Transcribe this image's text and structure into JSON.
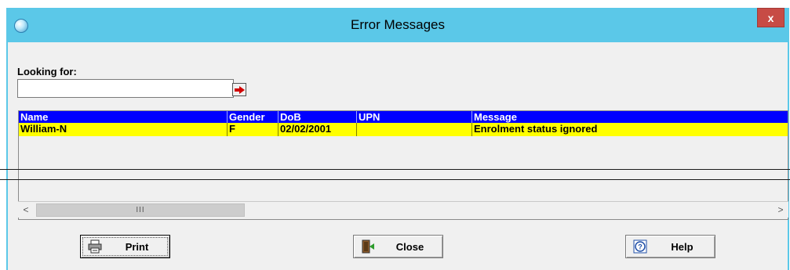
{
  "window": {
    "title": "Error Messages",
    "close_glyph": "x"
  },
  "search": {
    "label": "Looking for:",
    "value": "",
    "placeholder": ""
  },
  "table": {
    "columns": [
      "Name",
      "Gender",
      "DoB",
      "UPN",
      "Message"
    ],
    "rows": [
      {
        "name": "William-N",
        "gender": "F",
        "dob": "02/02/2001",
        "upn": "",
        "message": "Enrolment status ignored"
      }
    ]
  },
  "scrollbar": {
    "left_arrow": "<",
    "right_arrow": ">",
    "thumb_grip": "III"
  },
  "buttons": {
    "print": "Print",
    "close": "Close",
    "help": "Help"
  },
  "colors": {
    "titlebar": "#5bc8e8",
    "header_bg": "#0000ff",
    "row_highlight": "#ffff00",
    "window_close": "#c74b45"
  },
  "icons": {
    "app": "app-globe-icon",
    "go": "arrow-right-icon",
    "print": "printer-icon",
    "close": "door-exit-icon",
    "help": "question-icon"
  }
}
